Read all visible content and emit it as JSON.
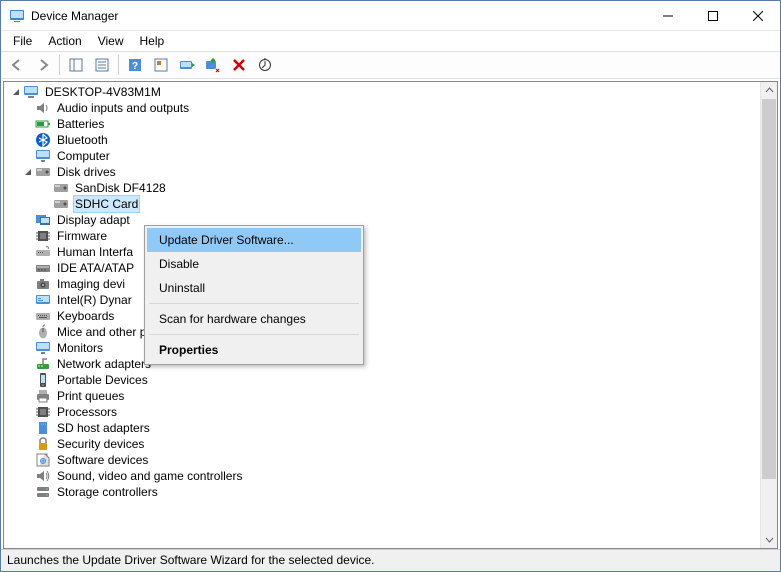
{
  "window": {
    "title": "Device Manager"
  },
  "menu": {
    "file": "File",
    "action": "Action",
    "view": "View",
    "help": "Help"
  },
  "tree": {
    "root": "DESKTOP-4V83M1M",
    "nodes": [
      {
        "k": "audio",
        "label": "Audio inputs and outputs"
      },
      {
        "k": "batteries",
        "label": "Batteries"
      },
      {
        "k": "bluetooth",
        "label": "Bluetooth"
      },
      {
        "k": "computer",
        "label": "Computer"
      },
      {
        "k": "disk",
        "label": "Disk drives",
        "expanded": true,
        "children": [
          {
            "k": "sandisk",
            "label": "SanDisk DF4128"
          },
          {
            "k": "sdhc",
            "label": "SDHC Card",
            "selected": true
          }
        ]
      },
      {
        "k": "display",
        "label": "Display adapt"
      },
      {
        "k": "firmware",
        "label": "Firmware"
      },
      {
        "k": "hid",
        "label": "Human Interfa"
      },
      {
        "k": "ide",
        "label": "IDE ATA/ATAP"
      },
      {
        "k": "imaging",
        "label": "Imaging devi"
      },
      {
        "k": "intel",
        "label": "Intel(R) Dynar"
      },
      {
        "k": "keyboards",
        "label": "Keyboards"
      },
      {
        "k": "mice",
        "label": "Mice and other pointing devices"
      },
      {
        "k": "monitors",
        "label": "Monitors"
      },
      {
        "k": "network",
        "label": "Network adapters"
      },
      {
        "k": "portable",
        "label": "Portable Devices"
      },
      {
        "k": "print",
        "label": "Print queues"
      },
      {
        "k": "processors",
        "label": "Processors"
      },
      {
        "k": "sdhost",
        "label": "SD host adapters"
      },
      {
        "k": "security",
        "label": "Security devices"
      },
      {
        "k": "software",
        "label": "Software devices"
      },
      {
        "k": "sound",
        "label": "Sound, video and game controllers"
      },
      {
        "k": "storage",
        "label": "Storage controllers"
      }
    ]
  },
  "context_menu": {
    "update": "Update Driver Software...",
    "disable": "Disable",
    "uninstall": "Uninstall",
    "scan": "Scan for hardware changes",
    "properties": "Properties"
  },
  "status": "Launches the Update Driver Software Wizard for the selected device."
}
